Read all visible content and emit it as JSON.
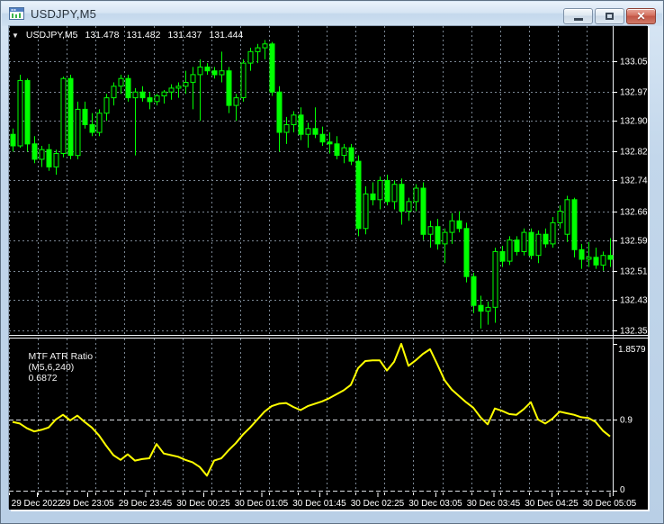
{
  "window": {
    "title": "USDJPY,M5",
    "buttons": {
      "minimize": "minimize",
      "restore": "restore",
      "close": "close"
    }
  },
  "chart": {
    "header": {
      "symbol": "USDJPY,M5",
      "open": "131.478",
      "high": "131.482",
      "low": "131.437",
      "close": "131.444"
    }
  },
  "indicator": {
    "name": "MTF ATR Ratio",
    "params": "(M5,6,240)",
    "value": "0.6872"
  },
  "colors": {
    "background": "#000000",
    "grid": "#7b8794",
    "candle": "#00ff00",
    "bull_fill": "#000000",
    "bear_fill": "#00ff00",
    "indicator_line": "#ffff00",
    "axis_text": "#ffffff",
    "level_line": "#d9dde2",
    "frame_line": "#edf1f5"
  },
  "chart_data": [
    {
      "type": "candlestick",
      "title": "USDJPY,M5",
      "ylim": [
        132.355,
        133.055
      ],
      "y_ticks": [
        "133.055",
        "132.975",
        "132.900",
        "132.820",
        "132.745",
        "132.665",
        "132.590",
        "132.510",
        "132.435",
        "132.355"
      ],
      "x_labels": [
        "29 Dec 2022",
        "29 Dec 23:05",
        "29 Dec 23:45",
        "30 Dec 00:25",
        "30 Dec 01:05",
        "30 Dec 01:45",
        "30 Dec 02:25",
        "30 Dec 03:05",
        "30 Dec 03:45",
        "30 Dec 04:25",
        "30 Dec 05:05"
      ],
      "grid": true,
      "ohlc": [
        [
          132.865,
          132.88,
          132.82,
          132.835
        ],
        [
          132.835,
          133.02,
          132.83,
          133.005
        ],
        [
          133.005,
          133.01,
          132.82,
          132.84
        ],
        [
          132.84,
          132.86,
          132.79,
          132.8
        ],
        [
          132.8,
          132.835,
          132.78,
          132.825
        ],
        [
          132.825,
          132.84,
          132.77,
          132.78
        ],
        [
          132.78,
          132.825,
          132.76,
          132.815
        ],
        [
          132.815,
          133.015,
          132.805,
          133.01
        ],
        [
          133.01,
          133.02,
          132.8,
          132.81
        ],
        [
          132.81,
          132.95,
          132.8,
          132.93
        ],
        [
          132.93,
          132.95,
          132.88,
          132.89
        ],
        [
          132.89,
          132.92,
          132.86,
          132.87
        ],
        [
          132.87,
          132.93,
          132.86,
          132.92
        ],
        [
          132.92,
          132.97,
          132.9,
          132.96
        ],
        [
          132.96,
          133.0,
          132.94,
          132.99
        ],
        [
          132.99,
          133.02,
          132.97,
          133.01
        ],
        [
          133.01,
          133.02,
          132.95,
          132.96
        ],
        [
          132.96,
          132.985,
          132.81,
          132.975
        ],
        [
          132.975,
          132.99,
          132.95,
          132.96
        ],
        [
          132.96,
          132.975,
          132.93,
          132.95
        ],
        [
          132.95,
          132.97,
          132.94,
          132.965
        ],
        [
          132.965,
          132.98,
          132.945,
          132.975
        ],
        [
          132.975,
          132.995,
          132.955,
          132.985
        ],
        [
          132.985,
          133.0,
          132.96,
          132.99
        ],
        [
          132.99,
          133.03,
          132.97,
          133.0
        ],
        [
          133.0,
          133.04,
          132.93,
          133.02
        ],
        [
          133.02,
          133.06,
          132.9,
          133.04
        ],
        [
          133.04,
          133.05,
          133.02,
          133.03
        ],
        [
          133.03,
          133.04,
          133.01,
          133.02
        ],
        [
          133.02,
          133.08,
          133.0,
          133.03
        ],
        [
          133.03,
          133.04,
          132.92,
          132.94
        ],
        [
          132.94,
          132.97,
          132.9,
          132.96
        ],
        [
          132.96,
          133.06,
          132.95,
          133.05
        ],
        [
          133.05,
          133.09,
          133.03,
          133.08
        ],
        [
          133.08,
          133.1,
          133.05,
          133.09
        ],
        [
          133.09,
          133.11,
          133.06,
          133.1
        ],
        [
          133.1,
          133.105,
          132.965,
          132.975
        ],
        [
          132.975,
          132.99,
          132.82,
          132.87
        ],
        [
          132.87,
          132.91,
          132.84,
          132.89
        ],
        [
          132.89,
          132.925,
          132.87,
          132.915
        ],
        [
          132.915,
          132.935,
          132.85,
          132.865
        ],
        [
          132.865,
          132.895,
          132.83,
          132.88
        ],
        [
          132.88,
          132.935,
          132.855,
          132.865
        ],
        [
          132.865,
          132.885,
          132.835,
          132.845
        ],
        [
          132.845,
          132.87,
          132.815,
          132.84
        ],
        [
          132.84,
          132.86,
          132.8,
          132.81
        ],
        [
          132.81,
          132.84,
          132.79,
          132.83
        ],
        [
          132.83,
          132.84,
          132.785,
          132.795
        ],
        [
          132.795,
          132.81,
          132.6,
          132.62
        ],
        [
          132.62,
          132.73,
          132.605,
          132.71
        ],
        [
          132.71,
          132.74,
          132.68,
          132.695
        ],
        [
          132.695,
          132.755,
          132.67,
          132.745
        ],
        [
          132.745,
          132.76,
          132.68,
          132.69
        ],
        [
          132.69,
          132.745,
          132.67,
          132.735
        ],
        [
          132.735,
          132.75,
          132.63,
          132.665
        ],
        [
          132.665,
          132.7,
          132.64,
          132.69
        ],
        [
          132.69,
          132.735,
          132.665,
          132.725
        ],
        [
          132.725,
          132.74,
          132.59,
          132.605
        ],
        [
          132.605,
          132.64,
          132.57,
          132.625
        ],
        [
          132.625,
          132.645,
          132.565,
          132.58
        ],
        [
          132.58,
          132.62,
          132.53,
          132.61
        ],
        [
          132.61,
          132.66,
          132.58,
          132.64
        ],
        [
          132.64,
          132.665,
          132.61,
          132.62
        ],
        [
          132.62,
          132.635,
          132.48,
          132.495
        ],
        [
          132.495,
          132.505,
          132.4,
          132.42
        ],
        [
          132.42,
          132.445,
          132.36,
          132.405
        ],
        [
          132.405,
          132.43,
          132.37,
          132.415
        ],
        [
          132.415,
          132.57,
          132.375,
          132.56
        ],
        [
          132.56,
          132.575,
          132.52,
          132.535
        ],
        [
          132.535,
          132.6,
          132.525,
          132.59
        ],
        [
          132.59,
          132.6,
          132.55,
          132.56
        ],
        [
          132.56,
          132.62,
          132.55,
          132.61
        ],
        [
          132.61,
          132.62,
          132.54,
          132.55
        ],
        [
          132.55,
          132.615,
          132.53,
          132.605
        ],
        [
          132.605,
          132.62,
          132.57,
          132.58
        ],
        [
          132.58,
          132.65,
          132.57,
          132.635
        ],
        [
          132.635,
          132.68,
          132.62,
          132.665
        ],
        [
          132.605,
          132.705,
          132.585,
          132.695
        ],
        [
          132.695,
          132.7,
          132.545,
          132.565
        ],
        [
          132.565,
          132.58,
          132.515,
          132.54
        ],
        [
          132.54,
          132.585,
          132.52,
          132.545
        ],
        [
          132.545,
          132.57,
          132.515,
          132.525
        ],
        [
          132.525,
          132.56,
          132.51,
          132.55
        ],
        [
          132.55,
          132.595,
          132.52,
          132.54
        ]
      ]
    },
    {
      "type": "line",
      "name": "MTF ATR Ratio (M5,6,240)",
      "current_value": "0.6872",
      "max_label": "1.8579",
      "levels": [
        0.9,
        0
      ],
      "level_labels": [
        "0.9",
        "0"
      ],
      "ylim": [
        0,
        1.95
      ],
      "values": [
        0.87,
        0.85,
        0.79,
        0.75,
        0.77,
        0.8,
        0.9,
        0.96,
        0.89,
        0.95,
        0.87,
        0.8,
        0.7,
        0.57,
        0.45,
        0.39,
        0.46,
        0.38,
        0.4,
        0.41,
        0.59,
        0.47,
        0.45,
        0.43,
        0.39,
        0.36,
        0.3,
        0.19,
        0.38,
        0.41,
        0.51,
        0.6,
        0.71,
        0.8,
        0.9,
        1.0,
        1.07,
        1.1,
        1.11,
        1.06,
        1.02,
        1.07,
        1.1,
        1.13,
        1.17,
        1.22,
        1.27,
        1.34,
        1.55,
        1.64,
        1.65,
        1.65,
        1.52,
        1.63,
        1.8579,
        1.58,
        1.65,
        1.73,
        1.79,
        1.6,
        1.4,
        1.28,
        1.2,
        1.12,
        1.05,
        0.93,
        0.84,
        1.04,
        1.01,
        0.97,
        0.96,
        1.03,
        1.12,
        0.9,
        0.85,
        0.91,
        1.0,
        0.98,
        0.96,
        0.93,
        0.92,
        0.87,
        0.76,
        0.6872
      ]
    }
  ]
}
